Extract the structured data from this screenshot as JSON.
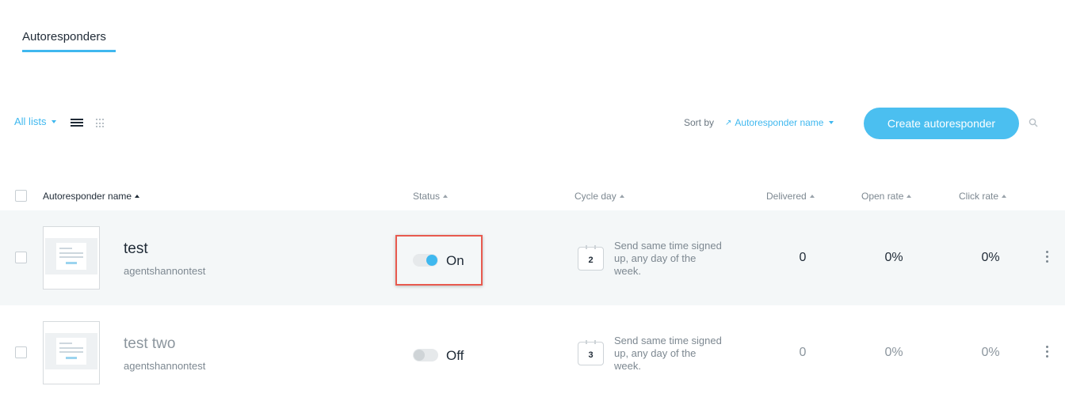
{
  "page_tab": "Autoresponders",
  "toolbar": {
    "all_lists": "All lists",
    "list_view_icon": "list-view-icon",
    "grid_view_icon": "grid-view-icon",
    "sort_by_label": "Sort by",
    "sort_value": "Autoresponder name",
    "create_button": "Create autoresponder",
    "search_icon": "search-icon"
  },
  "columns": {
    "name": "Autoresponder name",
    "status": "Status",
    "cycle_day": "Cycle day",
    "delivered": "Delivered",
    "open_rate": "Open rate",
    "click_rate": "Click rate"
  },
  "rows": [
    {
      "name": "test",
      "list": "agentshannontest",
      "status": "On",
      "cycle_day": "2",
      "cycle_text": "Send same time signed up, any day of the week.",
      "delivered": "0",
      "open_rate": "0%",
      "click_rate": "0%"
    },
    {
      "name": "test two",
      "list": "agentshannontest",
      "status": "Off",
      "cycle_day": "3",
      "cycle_text": "Send same time signed up, any day of the week.",
      "delivered": "0",
      "open_rate": "0%",
      "click_rate": "0%"
    }
  ],
  "colors": {
    "accent": "#3fb8ef",
    "highlight_border": "#e85a4f"
  }
}
